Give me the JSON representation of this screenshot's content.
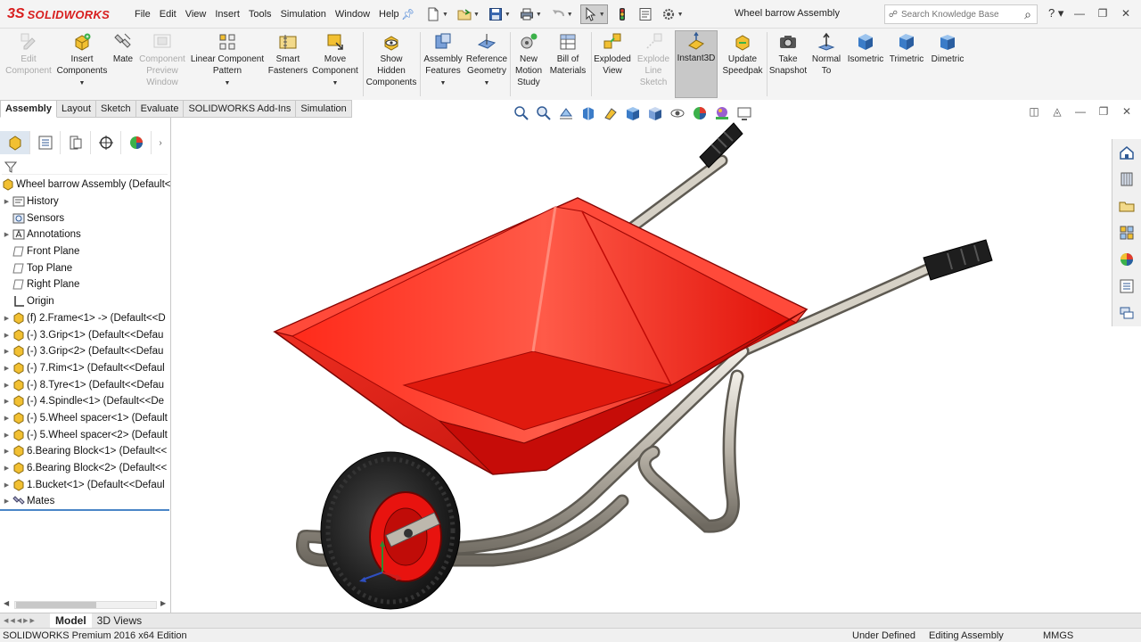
{
  "app": {
    "logo_prefix": "3S",
    "logo_name": "SOLIDWORKS",
    "document_title": "Wheel barrow Assembly"
  },
  "menu": [
    "File",
    "Edit",
    "View",
    "Insert",
    "Tools",
    "Simulation",
    "Window",
    "Help"
  ],
  "search": {
    "placeholder": "Search Knowledge Base"
  },
  "ribbon": {
    "edit_component": [
      "Edit",
      "Component"
    ],
    "insert_components": [
      "Insert",
      "Components"
    ],
    "mate": [
      "Mate"
    ],
    "component_preview": [
      "Component",
      "Preview",
      "Window"
    ],
    "linear_pattern": [
      "Linear Component",
      "Pattern"
    ],
    "smart_fasteners": [
      "Smart",
      "Fasteners"
    ],
    "move_component": [
      "Move",
      "Component"
    ],
    "show_hidden": [
      "Show",
      "Hidden",
      "Components"
    ],
    "assembly_features": [
      "Assembly",
      "Features"
    ],
    "reference_geometry": [
      "Reference",
      "Geometry"
    ],
    "new_motion_study": [
      "New",
      "Motion",
      "Study"
    ],
    "bill_of_materials": [
      "Bill of",
      "Materials"
    ],
    "exploded_view": [
      "Exploded",
      "View"
    ],
    "explode_line_sketch": [
      "Explode",
      "Line",
      "Sketch"
    ],
    "instant3d": [
      "Instant3D"
    ],
    "update_speedpak": [
      "Update",
      "Speedpak"
    ],
    "take_snapshot": [
      "Take",
      "Snapshot"
    ],
    "normal_to": [
      "Normal",
      "To"
    ],
    "isometric": [
      "Isometric"
    ],
    "trimetric": [
      "Trimetric"
    ],
    "dimetric": [
      "Dimetric"
    ]
  },
  "tabs": [
    "Assembly",
    "Layout",
    "Sketch",
    "Evaluate",
    "SOLIDWORKS Add-Ins",
    "Simulation"
  ],
  "tree": {
    "root": "Wheel barrow Assembly  (Default<",
    "items": [
      "History",
      "Sensors",
      "Annotations",
      "Front Plane",
      "Top Plane",
      "Right Plane",
      "Origin",
      "(f) 2.Frame<1> -> (Default<<D",
      "(-) 3.Grip<1> (Default<<Defau",
      "(-) 3.Grip<2> (Default<<Defau",
      "(-) 7.Rim<1> (Default<<Defaul",
      "(-) 8.Tyre<1> (Default<<Defau",
      "(-) 4.Spindle<1> (Default<<De",
      "(-) 5.Wheel spacer<1> (Default",
      "(-) 5.Wheel spacer<2> (Default",
      "6.Bearing Block<1> (Default<<",
      "6.Bearing Block<2> (Default<<",
      "1.Bucket<1> (Default<<Defaul",
      "Mates"
    ]
  },
  "bottom_tabs": [
    "Model",
    "3D Views"
  ],
  "status": {
    "edition": "SOLIDWORKS Premium 2016 x64 Edition",
    "definition": "Under Defined",
    "mode": "Editing Assembly",
    "units": "MMGS"
  },
  "colors": {
    "bucket_red": "#e8130f",
    "frame_silver": "#c7c2b8",
    "tyre_black": "#1d1d1d",
    "accent_blue": "#2f6fb5"
  },
  "icons": {
    "quick_access": [
      "new-document-icon",
      "open-icon",
      "save-icon",
      "print-icon",
      "undo-icon",
      "select-icon",
      "rebuild-icon",
      "file-properties-icon",
      "options-icon"
    ],
    "headsup": [
      "zoom-to-fit-icon",
      "zoom-to-area-icon",
      "previous-view-icon",
      "section-view-icon",
      "dynamic-annotation-icon",
      "view-orientation-icon",
      "display-style-icon",
      "hide-show-icon",
      "edit-appearance-icon",
      "apply-scene-icon",
      "view-settings-icon"
    ],
    "taskpane": [
      "solidworks-resources-icon",
      "design-library-icon",
      "file-explorer-icon",
      "view-palette-icon",
      "appearances-icon",
      "custom-properties-icon",
      "forum-icon"
    ]
  }
}
